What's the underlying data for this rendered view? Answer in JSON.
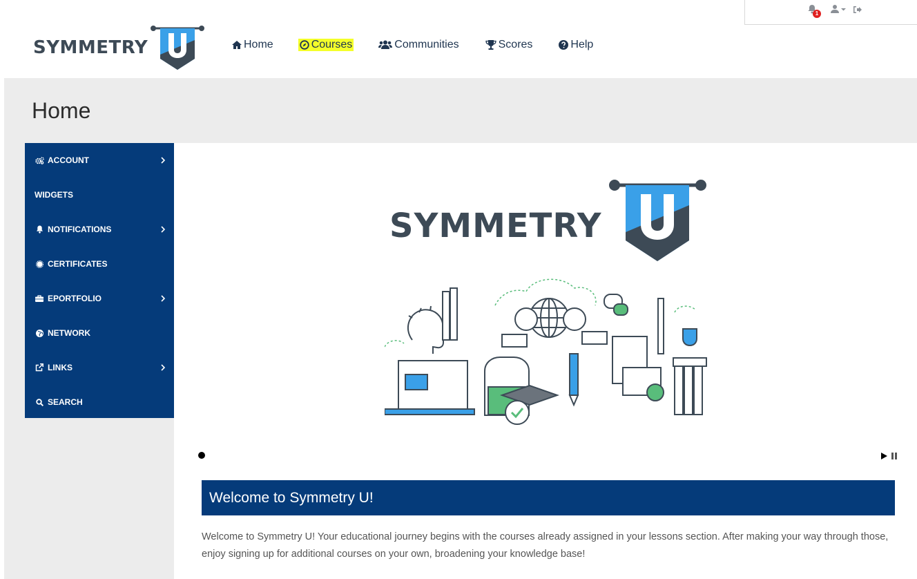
{
  "topbar": {
    "notification_count": "1",
    "bell_icon": "bell-icon",
    "user_icon": "user-dropdown-icon",
    "logout_icon": "sign-out-icon"
  },
  "brand": {
    "logo_text": "SYMMETRY",
    "logo_letter": "U",
    "colors": {
      "primary": "#053b7a",
      "accent": "#3aa0e8",
      "slate": "#3d4a56",
      "highlight": "#f4ff2a"
    }
  },
  "nav": {
    "items": [
      {
        "label": "Home",
        "icon": "home-icon"
      },
      {
        "label": "Courses",
        "icon": "compass-icon"
      },
      {
        "label": "Communities",
        "icon": "users-icon"
      },
      {
        "label": "Scores",
        "icon": "trophy-icon"
      },
      {
        "label": "Help",
        "icon": "question-circle-icon"
      }
    ]
  },
  "page": {
    "title": "Home"
  },
  "sidebar": {
    "items": [
      {
        "label": "ACCOUNT",
        "icon": "cogs-icon",
        "has_submenu": true
      },
      {
        "label": "WIDGETS",
        "icon": "",
        "has_submenu": false
      },
      {
        "label": "NOTIFICATIONS",
        "icon": "bell-icon",
        "has_submenu": true
      },
      {
        "label": "CERTIFICATES",
        "icon": "certificate-icon",
        "has_submenu": false
      },
      {
        "label": "EPORTFOLIO",
        "icon": "briefcase-icon",
        "has_submenu": true
      },
      {
        "label": "NETWORK",
        "icon": "globe-icon",
        "has_submenu": false
      },
      {
        "label": "LINKS",
        "icon": "external-link-icon",
        "has_submenu": true
      },
      {
        "label": "SEARCH",
        "icon": "search-icon",
        "has_submenu": false
      }
    ]
  },
  "hero": {
    "logo_text": "SYMMETRY",
    "logo_letter": "U",
    "slide_count": 1,
    "controls": [
      "play-icon",
      "pause-icon"
    ]
  },
  "welcome": {
    "heading": "Welcome to Symmetry U!",
    "body": "Welcome to Symmetry U! Your educational journey begins with the courses already assigned in your lessons section. After making your way through those, enjoy signing up for additional courses on your own, broadening your knowledge base!"
  }
}
